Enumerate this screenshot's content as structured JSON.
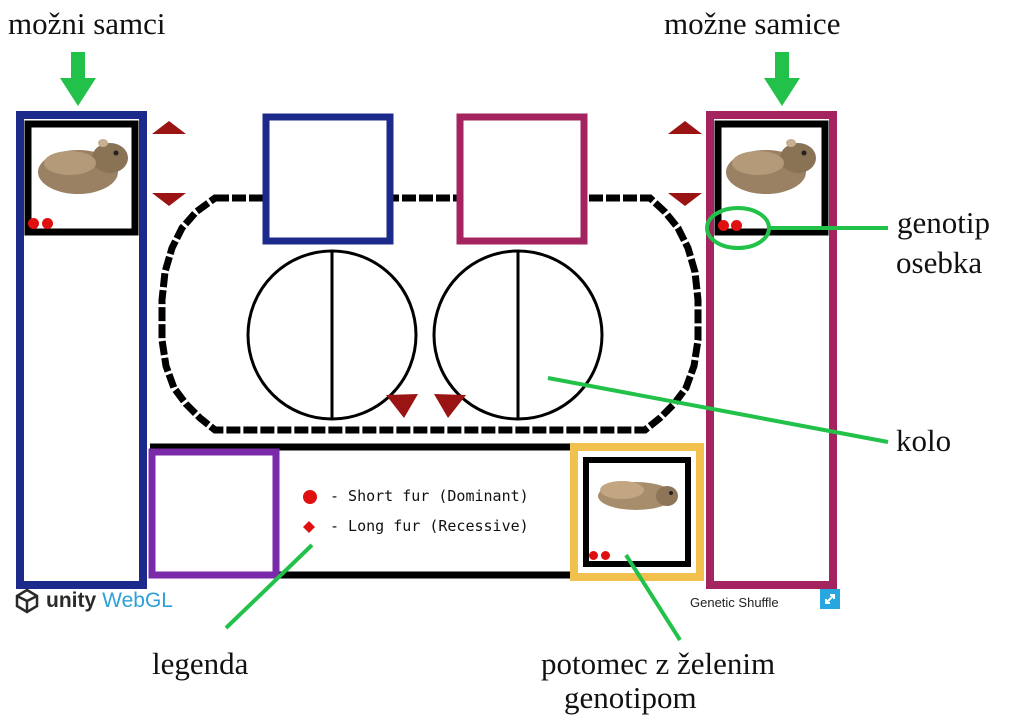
{
  "annotations": {
    "males_label": "možni samci",
    "females_label": "možne samice",
    "genotype_label_line1": "genotip",
    "genotype_label_line2": "osebka",
    "wheel_label": "kolo",
    "legend_label": "legenda",
    "offspring_label_line1": "potomec z želenim",
    "offspring_label_line2": "genotipom"
  },
  "legend": {
    "dominant_text": "- Short fur (Dominant)",
    "recessive_text": "- Long fur (Recessive)"
  },
  "footer": {
    "unity_brand": "unity",
    "unity_webgl": "WebGL",
    "game_title": "Genetic Shuffle"
  },
  "icons": {
    "animal": "guinea-pig-icon",
    "allele_dominant": "red-circle-icon",
    "allele_recessive": "red-diamond-icon",
    "arrow": "green-down-arrow-icon",
    "fullscreen": "fullscreen-icon",
    "unity_logo": "unity-logo-icon"
  },
  "colors": {
    "male_frame": "#1c2a8c",
    "female_frame": "#a3245e",
    "combine_frame": "#7a2aa8",
    "offspring_frame": "#f2c04e",
    "allele_red": "#e01010",
    "control_red": "#9b1414",
    "annotation_green": "#22c24a",
    "webgl_blue": "#2ea0d8"
  }
}
